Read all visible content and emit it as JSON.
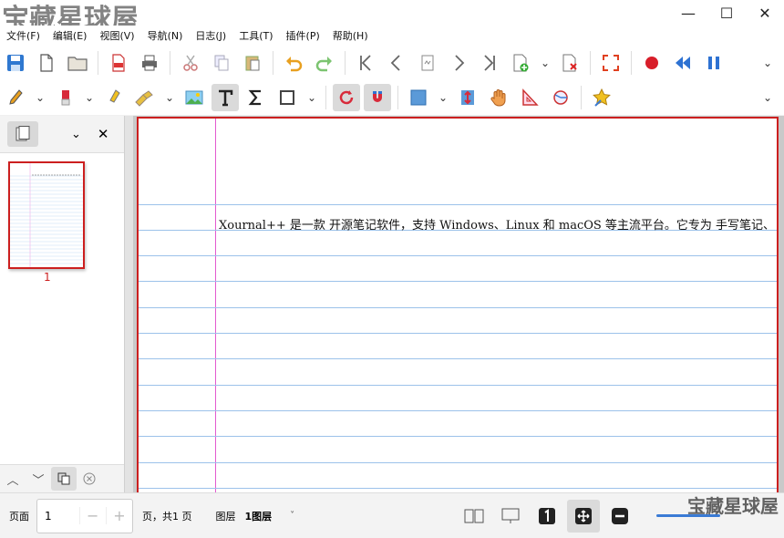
{
  "watermark": "宝藏星球屋",
  "window_controls": {
    "minimize": "—",
    "maximize": "☐",
    "close": "✕"
  },
  "menu": [
    "文件(F)",
    "编辑(E)",
    "视图(V)",
    "导航(N)",
    "日志(J)",
    "工具(T)",
    "插件(P)",
    "帮助(H)"
  ],
  "sidebar": {
    "page_number": "1"
  },
  "document": {
    "text": "Xournal++ 是一款 开源笔记软件，支持 Windows、Linux 和 macOS 等主流平台。它专为 手写笔记、"
  },
  "status": {
    "page_label": "页面",
    "page_value": "1",
    "page_total": "页，共1 页",
    "layer_label": "图层",
    "layer_value": "1图层",
    "layer_dropdown": "˅"
  },
  "colors": {
    "accent_red": "#cc1f1f",
    "rule_blue": "#9cc2ea",
    "margin_pink": "#e35ad0"
  }
}
